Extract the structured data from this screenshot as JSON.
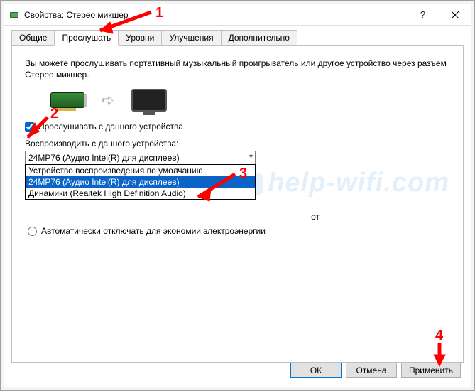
{
  "window": {
    "title": "Свойства: Стерео микшер",
    "icon_name": "properties-icon"
  },
  "tabs": {
    "items": [
      {
        "label": "Общие",
        "active": false
      },
      {
        "label": "Прослушать",
        "active": true
      },
      {
        "label": "Уровни",
        "active": false
      },
      {
        "label": "Улучшения",
        "active": false
      },
      {
        "label": "Дополнительно",
        "active": false
      }
    ]
  },
  "listen": {
    "description": "Вы можете прослушивать портативный музыкальный проигрыватель или другое устройство через разъем Стерео микшер.",
    "checkbox_label": "Прослушивать с данного устройства",
    "checkbox_checked": true,
    "device_label": "Воспроизводить с данного устройства:",
    "device_selected": "24MP76 (Аудио Intel(R) для дисплеев)",
    "device_options": [
      "Устройство воспроизведения по умолчанию",
      "24MP76 (Аудио Intel(R) для дисплеев)",
      "Динамики (Realtek High Definition Audio)"
    ],
    "device_highlighted_index": 1,
    "radio_partial_visible": "от",
    "radio_auto_off": "Автоматически отключать для экономии электроэнергии"
  },
  "buttons": {
    "ok": "ОК",
    "cancel": "Отмена",
    "apply": "Применить"
  },
  "annotations": {
    "n1": "1",
    "n2": "2",
    "n3": "3",
    "n4": "4"
  },
  "watermark": "help-wifi.com"
}
